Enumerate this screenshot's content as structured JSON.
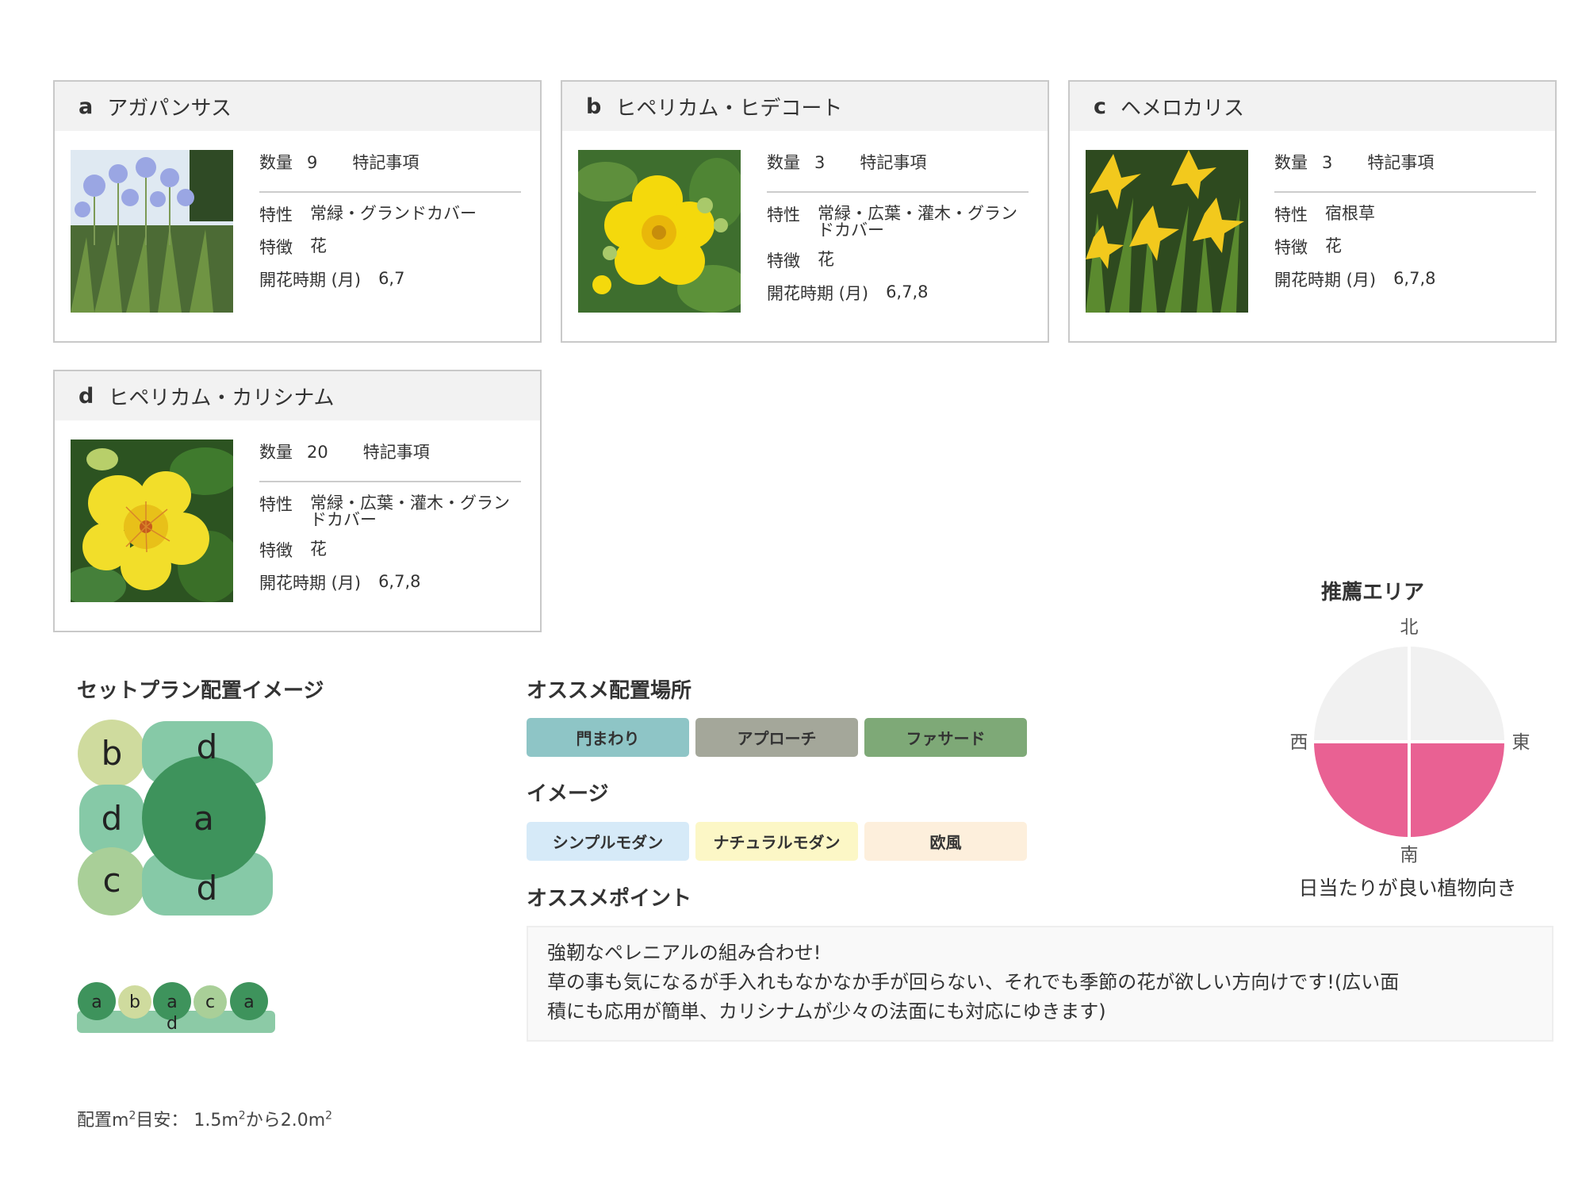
{
  "cards": [
    {
      "letter": "a",
      "name": "アガパンサス",
      "qty_label": "数量",
      "qty": "9",
      "note_label": "特記事項",
      "rows": [
        {
          "k": "特性",
          "v": "常緑・グランドカバー"
        },
        {
          "k": "特徴",
          "v": "花"
        },
        {
          "k": "開花時期 (月)",
          "v": "6,7"
        }
      ]
    },
    {
      "letter": "b",
      "name": "ヒペリカム・ヒデコート",
      "qty_label": "数量",
      "qty": "3",
      "note_label": "特記事項",
      "rows": [
        {
          "k": "特性",
          "v": "常緑・広葉・灌木・グランドカバー"
        },
        {
          "k": "特徴",
          "v": "花"
        },
        {
          "k": "開花時期 (月)",
          "v": "6,7,8"
        }
      ]
    },
    {
      "letter": "c",
      "name": "ヘメロカリス",
      "qty_label": "数量",
      "qty": "3",
      "note_label": "特記事項",
      "rows": [
        {
          "k": "特性",
          "v": "宿根草"
        },
        {
          "k": "特徴",
          "v": "花"
        },
        {
          "k": "開花時期 (月)",
          "v": "6,7,8"
        }
      ]
    },
    {
      "letter": "d",
      "name": "ヒペリカム・カリシナム",
      "qty_label": "数量",
      "qty": "20",
      "note_label": "特記事項",
      "rows": [
        {
          "k": "特性",
          "v": "常緑・広葉・灌木・グランドカバー"
        },
        {
          "k": "特徴",
          "v": "花"
        },
        {
          "k": "開花時期 (月)",
          "v": "6,7,8"
        }
      ]
    }
  ],
  "plan": {
    "title": "セットプラン配置イメージ",
    "top_view": {
      "b": "b",
      "d1": "d",
      "d2": "d",
      "a": "a",
      "c": "c",
      "d3": "d"
    },
    "side_view": [
      "a",
      "b",
      "a",
      "c",
      "a",
      "d"
    ],
    "area_prefix": "配置m",
    "area_sup1": "2",
    "area_mid": "目安： 1.5m",
    "area_sup2": "2",
    "area_mid2": "から2.0m",
    "area_sup3": "2"
  },
  "placement": {
    "title": "オススメ配置場所",
    "tags": [
      {
        "label": "門まわり",
        "color": "#8ec5c6"
      },
      {
        "label": "アプローチ",
        "color": "#a4a79a"
      },
      {
        "label": "ファサード",
        "color": "#7ea977"
      }
    ]
  },
  "image": {
    "title": "イメージ",
    "tags": [
      {
        "label": "シンプルモダン",
        "color": "#d6eaf8"
      },
      {
        "label": "ナチュラルモダン",
        "color": "#fcf7c6"
      },
      {
        "label": "欧風",
        "color": "#fdefdc"
      }
    ]
  },
  "point": {
    "title": "オススメポイント",
    "lines": [
      "強靭なペレニアルの組み合わせ!",
      "草の事も気になるが手入れもなかなか手が回らない、それでも季節の花が欲しい方向けです!(広い面",
      "積にも応用が簡単、カリシナムが少々の法面にも対応にゆきます)"
    ]
  },
  "area": {
    "title": "推薦エリア",
    "north": "北",
    "east": "東",
    "south": "南",
    "west": "西",
    "caption": "日当たりが良い植物向き",
    "colors": {
      "active": "#e96193",
      "inactive": "#f1f1f1"
    }
  }
}
